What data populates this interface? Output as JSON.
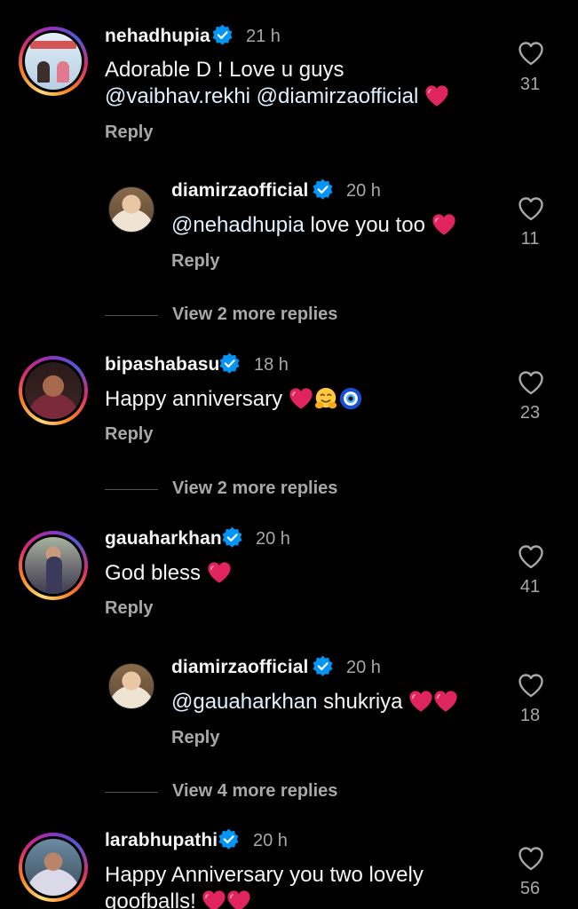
{
  "comments": [
    {
      "username": "nehadhupia",
      "time": "21 h",
      "text_line1": "Adorable D ! Love u guys",
      "mention1": "@vaibhav.rekhi",
      "mention2": "@diamirzaofficial",
      "reply": "Reply",
      "likes": "31",
      "avatar_caption": "Social Distancing",
      "emojis": [
        "red-heart"
      ]
    },
    {
      "username": "diamirzaofficial",
      "time": "20 h",
      "mention": "@nehadhupia",
      "text": "love you too",
      "reply": "Reply",
      "likes": "11",
      "emojis": [
        "red-heart"
      ]
    },
    {
      "view_more": "View 2 more replies"
    },
    {
      "username": "bipashabasu",
      "time": "18 h",
      "text": "Happy anniversary",
      "reply": "Reply",
      "likes": "23",
      "emojis": [
        "red-heart",
        "hugging-face",
        "nazar-amulet"
      ]
    },
    {
      "view_more": "View 2 more replies"
    },
    {
      "username": "gauaharkhan",
      "time": "20 h",
      "text": "God bless",
      "reply": "Reply",
      "likes": "41",
      "emojis": [
        "red-heart"
      ]
    },
    {
      "username": "diamirzaofficial",
      "time": "20 h",
      "mention": "@gauaharkhan",
      "text": "shukriya",
      "reply": "Reply",
      "likes": "18",
      "emojis": [
        "red-heart",
        "red-heart"
      ]
    },
    {
      "view_more": "View 4 more replies"
    },
    {
      "username": "larabhupathi",
      "time": "20 h",
      "text_line1": "Happy Anniversary you two lovely",
      "text_line2": "goofballs!",
      "likes": "56",
      "emojis": [
        "red-heart",
        "red-heart"
      ]
    }
  ],
  "colors": {
    "background": "#000000",
    "text": "#f5f5f5",
    "muted": "#a8a8a8",
    "verified": "#0095f6",
    "heart_emoji": "#e0245e"
  }
}
